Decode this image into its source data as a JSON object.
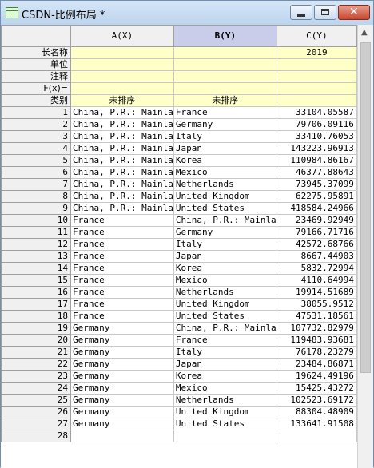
{
  "window": {
    "title": "CSDN-比例布局 *"
  },
  "columns": [
    {
      "header": "A(X)"
    },
    {
      "header": "B(Y)"
    },
    {
      "header": "C(Y)"
    }
  ],
  "meta_rows": [
    {
      "label": "长名称",
      "a": "",
      "b": "",
      "c": "2019"
    },
    {
      "label": "单位",
      "a": "",
      "b": "",
      "c": ""
    },
    {
      "label": "注释",
      "a": "",
      "b": "",
      "c": ""
    },
    {
      "label": "F(x)=",
      "a": "",
      "b": "",
      "c": ""
    },
    {
      "label": "类别",
      "a": "未排序",
      "b": "未排序",
      "c": ""
    }
  ],
  "rows": [
    {
      "n": "1",
      "a": "China, P.R.: Mainla",
      "b": "France",
      "c": "33104.05587"
    },
    {
      "n": "2",
      "a": "China, P.R.: Mainla",
      "b": "Germany",
      "c": "79706.09116"
    },
    {
      "n": "3",
      "a": "China, P.R.: Mainla",
      "b": "Italy",
      "c": "33410.76053"
    },
    {
      "n": "4",
      "a": "China, P.R.: Mainla",
      "b": "Japan",
      "c": "143223.96913"
    },
    {
      "n": "5",
      "a": "China, P.R.: Mainla",
      "b": "Korea",
      "c": "110984.86167"
    },
    {
      "n": "6",
      "a": "China, P.R.: Mainla",
      "b": "Mexico",
      "c": "46377.88643"
    },
    {
      "n": "7",
      "a": "China, P.R.: Mainla",
      "b": "Netherlands",
      "c": "73945.37099"
    },
    {
      "n": "8",
      "a": "China, P.R.: Mainla",
      "b": "United Kingdom",
      "c": "62275.95891"
    },
    {
      "n": "9",
      "a": "China, P.R.: Mainla",
      "b": "United States",
      "c": "418584.24966"
    },
    {
      "n": "10",
      "a": "France",
      "b": "China, P.R.: Mainla",
      "c": "23469.92949"
    },
    {
      "n": "11",
      "a": "France",
      "b": "Germany",
      "c": "79166.71716"
    },
    {
      "n": "12",
      "a": "France",
      "b": "Italy",
      "c": "42572.68766"
    },
    {
      "n": "13",
      "a": "France",
      "b": "Japan",
      "c": "8667.44903"
    },
    {
      "n": "14",
      "a": "France",
      "b": "Korea",
      "c": "5832.72994"
    },
    {
      "n": "15",
      "a": "France",
      "b": "Mexico",
      "c": "4110.64994"
    },
    {
      "n": "16",
      "a": "France",
      "b": "Netherlands",
      "c": "19914.51689"
    },
    {
      "n": "17",
      "a": "France",
      "b": "United Kingdom",
      "c": "38055.9512"
    },
    {
      "n": "18",
      "a": "France",
      "b": "United States",
      "c": "47531.18561"
    },
    {
      "n": "19",
      "a": "Germany",
      "b": "China, P.R.: Mainla",
      "c": "107732.82979"
    },
    {
      "n": "20",
      "a": "Germany",
      "b": "France",
      "c": "119483.93681"
    },
    {
      "n": "21",
      "a": "Germany",
      "b": "Italy",
      "c": "76178.23279"
    },
    {
      "n": "22",
      "a": "Germany",
      "b": "Japan",
      "c": "23484.86871"
    },
    {
      "n": "23",
      "a": "Germany",
      "b": "Korea",
      "c": "19624.49196"
    },
    {
      "n": "24",
      "a": "Germany",
      "b": "Mexico",
      "c": "15425.43272"
    },
    {
      "n": "25",
      "a": "Germany",
      "b": "Netherlands",
      "c": "102523.69172"
    },
    {
      "n": "26",
      "a": "Germany",
      "b": "United Kingdom",
      "c": "88304.48909"
    },
    {
      "n": "27",
      "a": "Germany",
      "b": "United States",
      "c": "133641.91508"
    },
    {
      "n": "28",
      "a": "",
      "b": "",
      "c": ""
    }
  ],
  "icons": {
    "app": "worksheet-icon",
    "minimize": "minimize-icon",
    "maximize": "maximize-icon",
    "close": "close-icon",
    "scroll_up": "chevron-up-icon"
  },
  "glyphs": {
    "close": "✕",
    "scroll_up": "▲"
  },
  "colors": {
    "meta_background": "#ffffc8",
    "selected_column_header": "#c9cdea",
    "close_button": "#c7452d"
  }
}
